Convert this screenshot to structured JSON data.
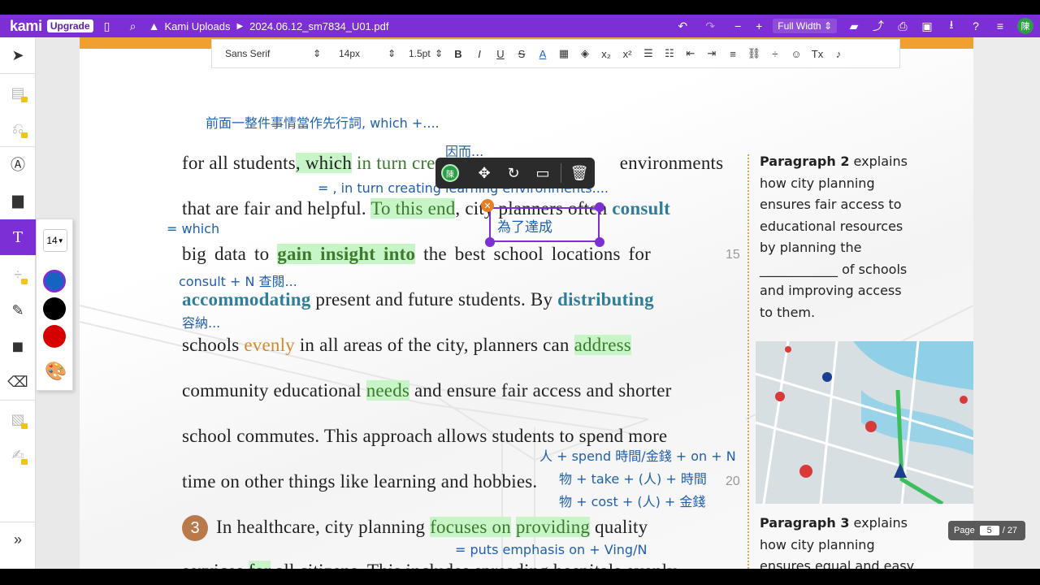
{
  "app": {
    "logo": "kami",
    "upgrade": "Upgrade",
    "folder": "Kami Uploads",
    "filename": "2024.06.12_sm7834_U01.pdf",
    "view_mode": "Full Width",
    "avatar": "陳"
  },
  "format_bar": {
    "font": "Sans Serif",
    "size": "14px",
    "line": "1.5pt"
  },
  "palette": {
    "font_size": "14",
    "colors": [
      "#1565c0",
      "#000000",
      "#d50000"
    ]
  },
  "document": {
    "lines": [
      {
        "segments": [
          "for all students",
          ", which",
          " in turn creat",
          "ing learning environments"
        ]
      },
      {
        "segments": [
          "that are fair and helpful. ",
          "To this end",
          ", city planners often ",
          "consult"
        ]
      },
      {
        "segments": [
          "big data to ",
          "gain insight into",
          " the best school locations for"
        ]
      },
      {
        "segments": [
          "accommodating",
          " present and future students. By ",
          "distributing"
        ]
      },
      {
        "segments": [
          "schools ",
          "evenly",
          " in all areas of the city, planners can ",
          "address"
        ]
      },
      {
        "segments": [
          "community educational ",
          "needs",
          " and ensure fair access and shorter"
        ]
      },
      {
        "segments": [
          "school commutes. This approach allows students to spend more"
        ]
      },
      {
        "segments": [
          "time on other things like learning and hobbies."
        ]
      },
      {
        "segments": [
          "In healthcare, city planning ",
          "focuses on",
          " ",
          "providing",
          " quality"
        ]
      },
      {
        "segments": [
          "services ",
          "for",
          " all citizens. This includes spreading hospitals evenly"
        ]
      }
    ],
    "paragraph_number": "3",
    "line_numbers": [
      "15",
      "20"
    ]
  },
  "annotations": {
    "a1": "前面一整件事情當作先行詞, which +....",
    "a2": "因而...",
    "a3": "= , in turn creating learning environments....",
    "a4": "= which",
    "a5": "為了達成",
    "a6": "consult + N 查閱...",
    "a7": "容納...",
    "a8": "人 + spend 時間/金錢 + on + N",
    "a9": "物 + take + (人) + 時間",
    "a10": "物 + cost + (人) + 金錢",
    "a11": "= puts emphasis on + Ving/N"
  },
  "sidebar": {
    "p2_bold": "Paragraph 2",
    "p2_lines": [
      " explains",
      "how city planning",
      "ensures fair access to",
      "educational resources",
      "by planning the",
      "____________ of schools",
      "and improving access",
      "to them."
    ],
    "p3_bold": "Paragraph 3",
    "p3_lines": [
      " explains",
      "how city planning",
      "ensures equal and easy"
    ]
  },
  "pager": {
    "label": "Page",
    "current": "5",
    "total": "/ 27"
  }
}
